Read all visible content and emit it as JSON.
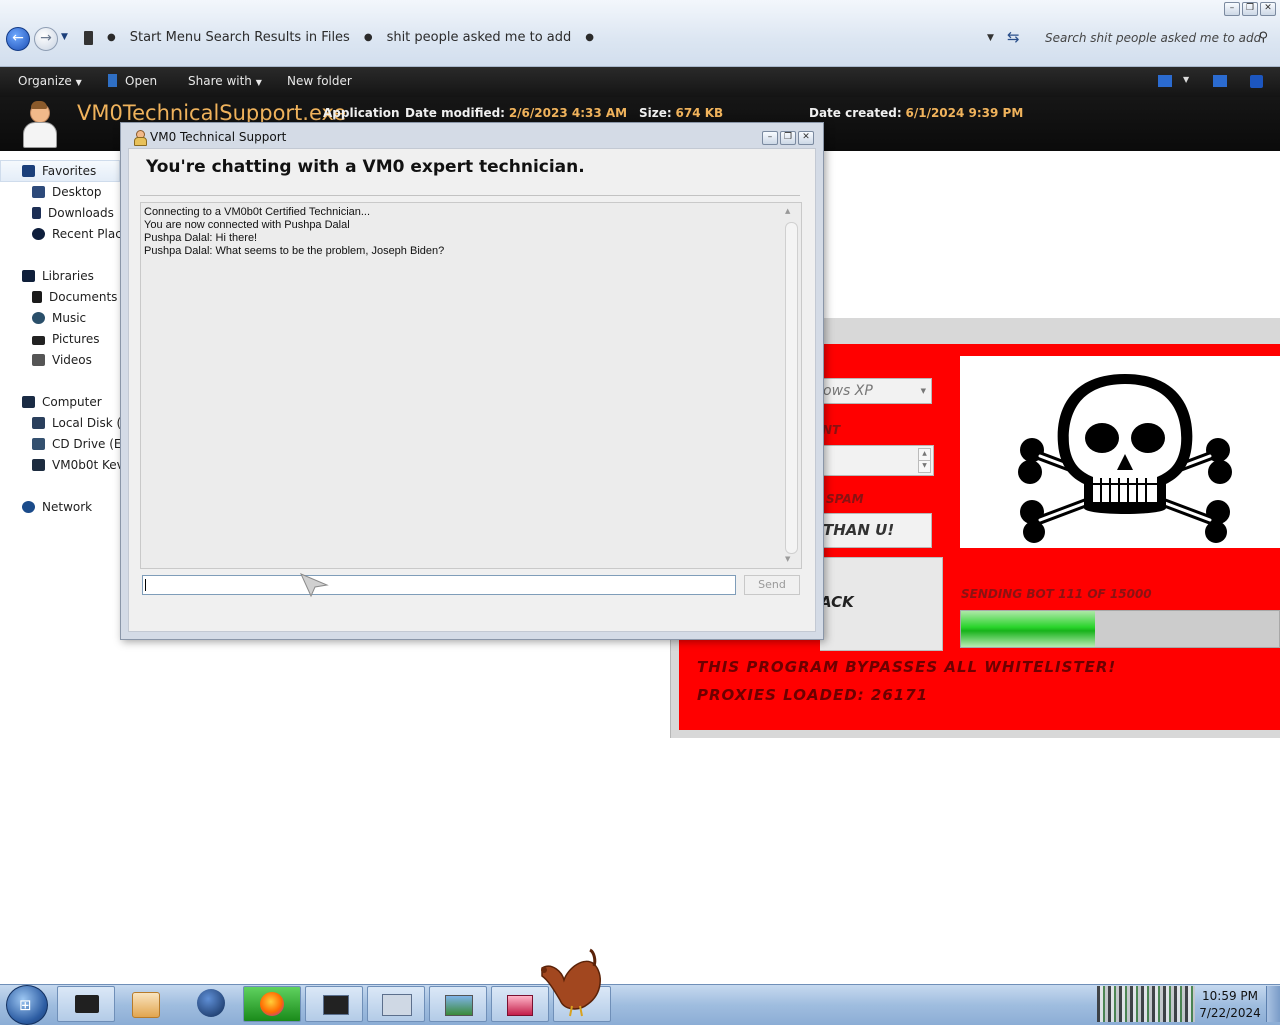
{
  "explorer": {
    "breadcrumbs": [
      "Start Menu Search Results in Files",
      "shit people asked me to add"
    ],
    "search_placeholder": "Search shit people asked me to add",
    "toolbar": {
      "organize": "Organize",
      "open": "Open",
      "share_with": "Share with",
      "new_folder": "New folder"
    },
    "details": {
      "file_name": "VM0TechnicalSupport.exe",
      "type": "Application",
      "date_modified_label": "Date modified:",
      "date_modified": "2/6/2023 4:33 AM",
      "size_label": "Size:",
      "size": "674 KB",
      "date_created_label": "Date created:",
      "date_created": "6/1/2024 9:39 PM"
    },
    "nav": {
      "favorites": "Favorites",
      "desktop": "Desktop",
      "downloads": "Downloads",
      "recent_places": "Recent Places",
      "libraries": "Libraries",
      "documents": "Documents",
      "music": "Music",
      "pictures": "Pictures",
      "videos": "Videos",
      "computer": "Computer",
      "local_disk": "Local Disk (C:)",
      "cd_drive": "CD Drive (E:)",
      "vm0b0t": "VM0b0t Kevin",
      "network": "Network"
    }
  },
  "background_app": {
    "os_field": "ows XP",
    "label_nt": "NT",
    "label_spam": "SPAM",
    "field_than": "THAN U!",
    "button_ack": "ACK",
    "sending_text": "SENDING BOT 111 OF 15000",
    "bypass_text": "THIS PROGRAM BYPASSES ALL WHITELISTER!",
    "proxies_text": "PROXIES LOADED: 26171",
    "progress_fraction": 0.42,
    "colors": {
      "background": "#ff0000",
      "text": "#6d0000",
      "progress": "#22c922"
    }
  },
  "chat_dialog": {
    "title": "VM0 Technical Support",
    "headline": "You're chatting with a VM0 expert technician.",
    "messages": [
      "Connecting to a VM0b0t Certified Technician...",
      "You are now connected with Pushpa Dalal",
      "Pushpa Dalal: Hi there!",
      "Pushpa Dalal: What seems to be the problem, Joseph Biden?"
    ],
    "input_value": "",
    "send_label": "Send"
  },
  "taskbar": {
    "time": "10:59 PM",
    "date": "7/22/2024"
  }
}
